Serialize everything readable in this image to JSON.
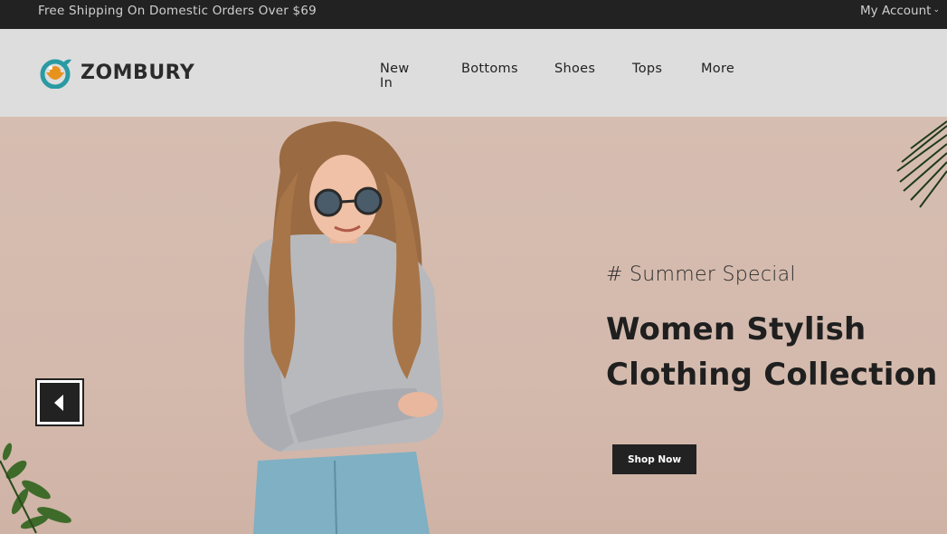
{
  "topbar": {
    "promo": "Free Shipping On Domestic Orders Over $69",
    "account": "My Account"
  },
  "header": {
    "logo_text": "ZOMBURY",
    "nav": [
      {
        "label": "New In"
      },
      {
        "label": "Bottoms"
      },
      {
        "label": "Shoes"
      },
      {
        "label": "Tops"
      },
      {
        "label": "More"
      }
    ]
  },
  "hero": {
    "tag": "# Summer Special",
    "headline_line1": "Women Stylish",
    "headline_line2": "Clothing Collection",
    "cta": "Shop Now"
  },
  "colors": {
    "topbar_bg": "#222222",
    "header_bg": "#dddddd",
    "hero_bg": "#d6bdb1",
    "logo_teal": "#2a9aa3",
    "logo_orange": "#e8921e"
  }
}
